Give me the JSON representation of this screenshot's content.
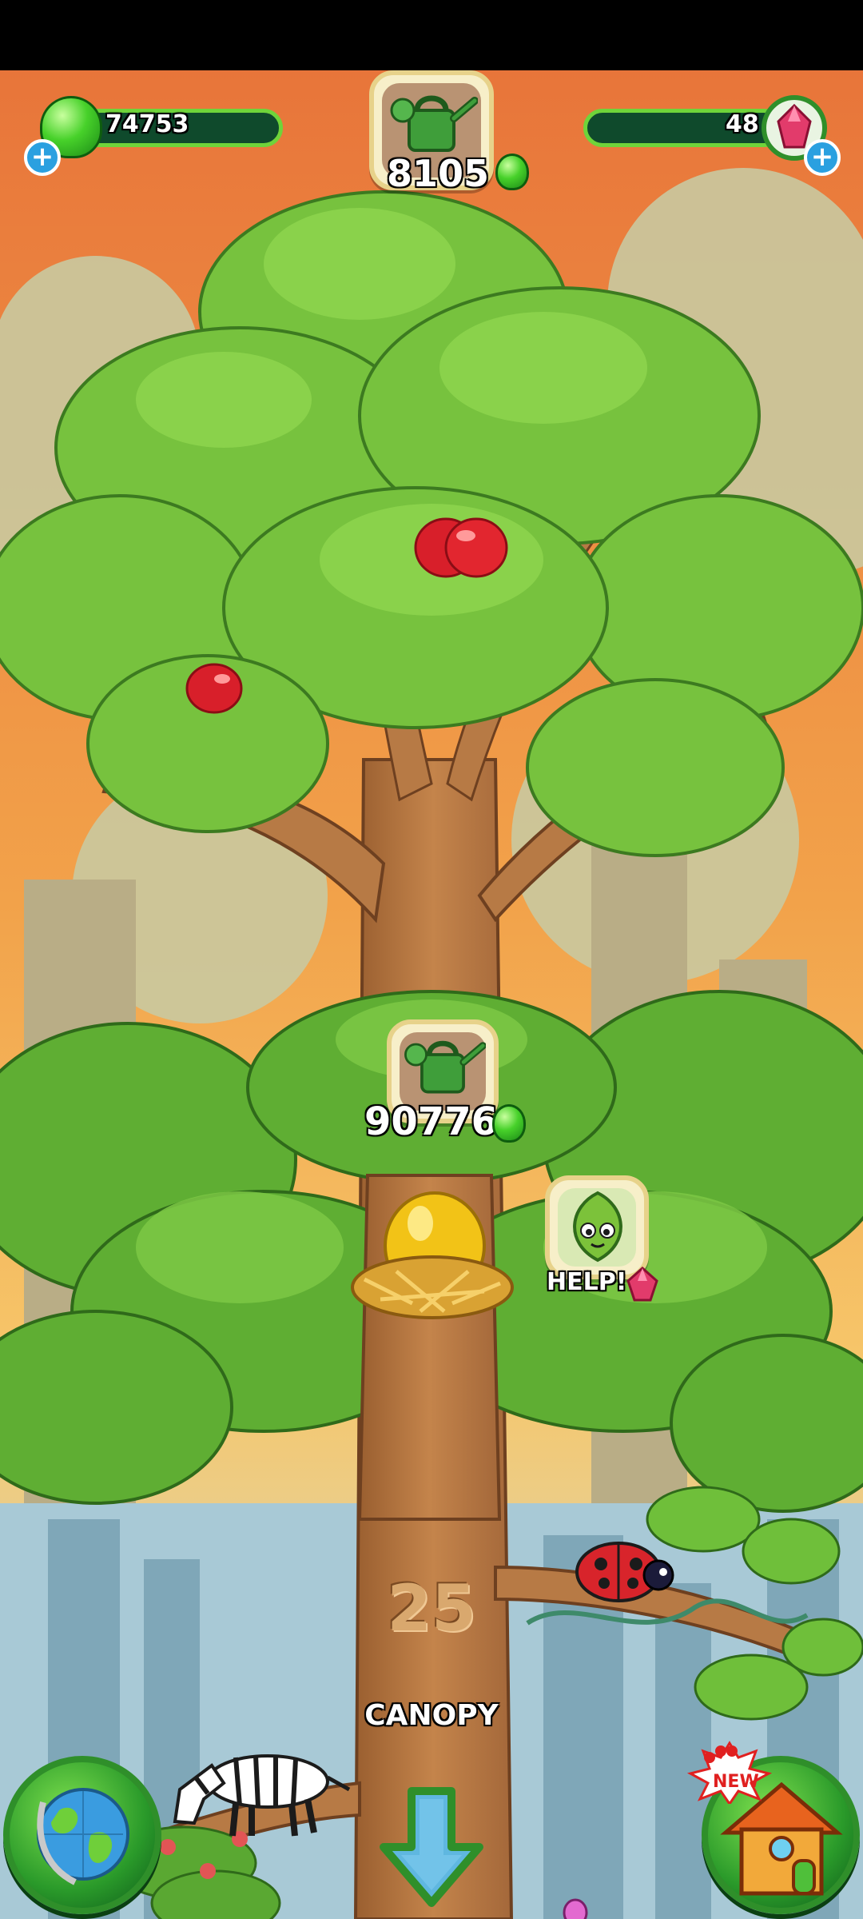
{
  "hud": {
    "gems_green": "74753",
    "gems_red": "48",
    "top_water_cost": "8105",
    "mid_water_cost": "90776"
  },
  "tree": {
    "level_number": "25",
    "zone_label": "CANOPY",
    "help_label": "HELP!",
    "new_badge": "NEW"
  },
  "icons": {
    "watering_can": "watering-can-icon",
    "green_gem": "green-gem-icon",
    "red_gem": "red-gem-icon",
    "globe": "globe-icon",
    "house": "house-icon",
    "down_arrow": "down-arrow-icon"
  },
  "colors": {
    "sky_top": "#e8753a",
    "sky_mid": "#f2a24a",
    "hud_bar": "#0f4a2c",
    "hud_border": "#6fd43a",
    "leaf": "#6fbf3a",
    "trunk": "#b77a45"
  }
}
